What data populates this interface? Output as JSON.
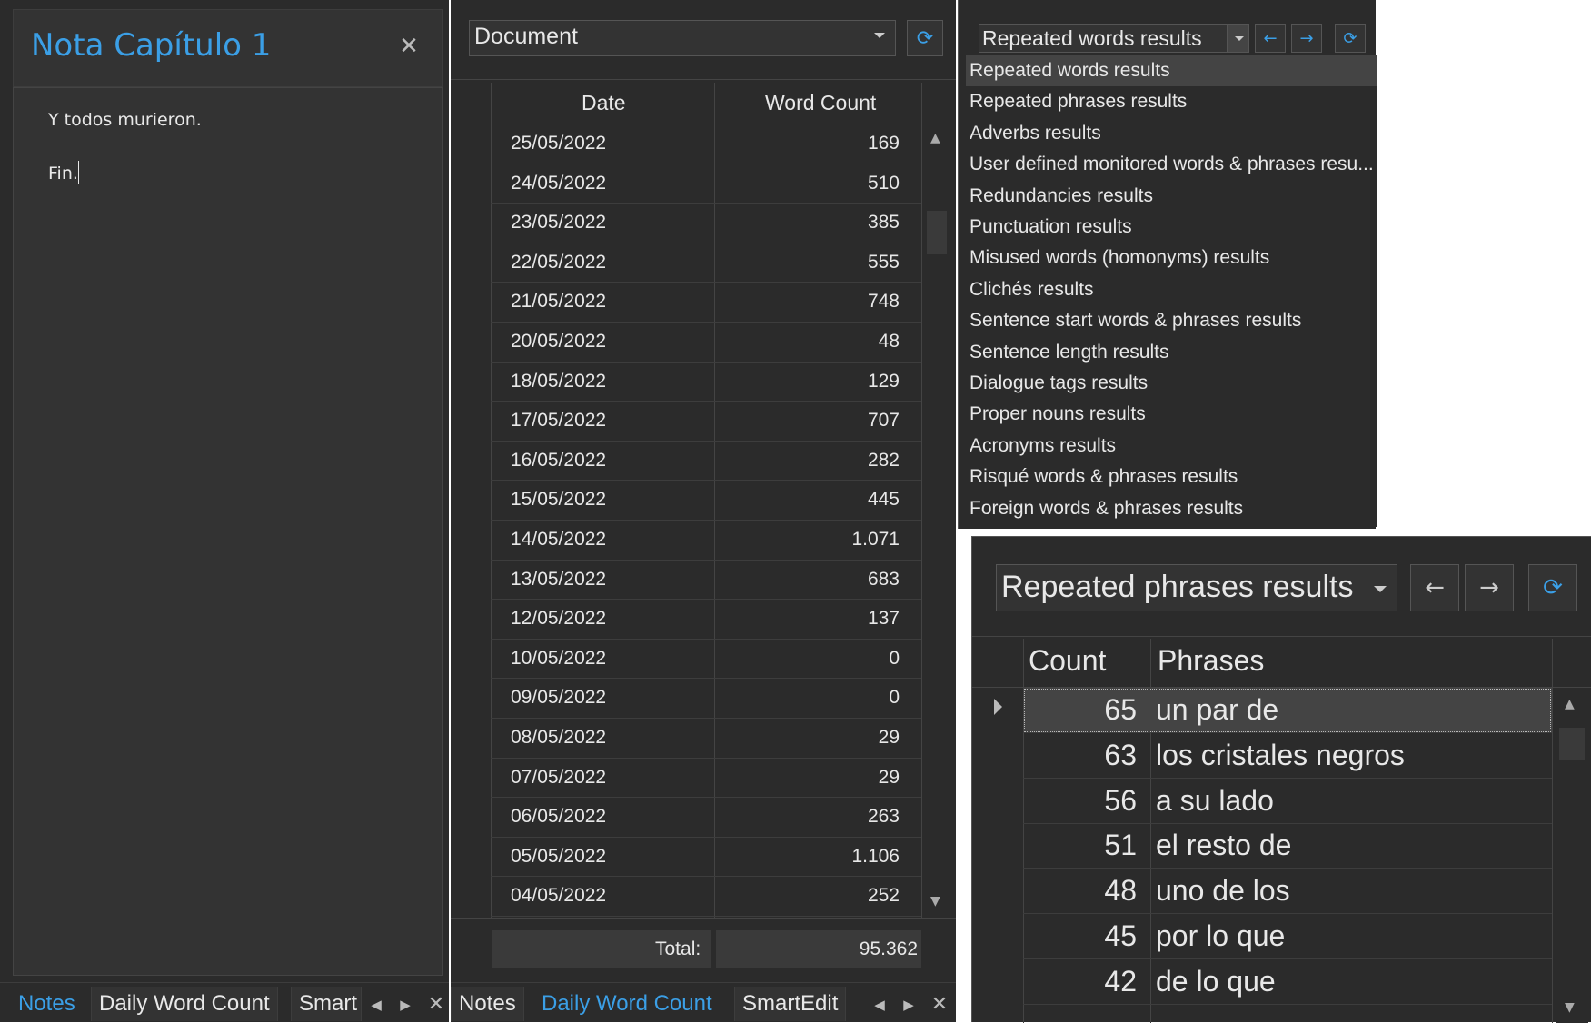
{
  "notes_panel": {
    "title": "Nota Capítulo 1",
    "close_icon": "close-icon",
    "lines": [
      "Y todos murieron.",
      "Fin."
    ],
    "tabs": [
      "Notes",
      "Daily Word Count",
      "Smart"
    ]
  },
  "word_count_panel": {
    "scope_select": "Document",
    "columns": [
      "Date",
      "Word Count"
    ],
    "rows": [
      {
        "date": "25/05/2022",
        "count": "169"
      },
      {
        "date": "24/05/2022",
        "count": "510"
      },
      {
        "date": "23/05/2022",
        "count": "385"
      },
      {
        "date": "22/05/2022",
        "count": "555"
      },
      {
        "date": "21/05/2022",
        "count": "748"
      },
      {
        "date": "20/05/2022",
        "count": "48"
      },
      {
        "date": "18/05/2022",
        "count": "129"
      },
      {
        "date": "17/05/2022",
        "count": "707"
      },
      {
        "date": "16/05/2022",
        "count": "282"
      },
      {
        "date": "15/05/2022",
        "count": "445"
      },
      {
        "date": "14/05/2022",
        "count": "1.071"
      },
      {
        "date": "13/05/2022",
        "count": "683"
      },
      {
        "date": "12/05/2022",
        "count": "137"
      },
      {
        "date": "10/05/2022",
        "count": "0"
      },
      {
        "date": "09/05/2022",
        "count": "0"
      },
      {
        "date": "08/05/2022",
        "count": "29"
      },
      {
        "date": "07/05/2022",
        "count": "29"
      },
      {
        "date": "06/05/2022",
        "count": "263"
      },
      {
        "date": "05/05/2022",
        "count": "1.106"
      },
      {
        "date": "04/05/2022",
        "count": "252"
      }
    ],
    "total_label": "Total:",
    "total_value": "95.362",
    "tabs": [
      "Notes",
      "Daily Word Count",
      "SmartEdit"
    ]
  },
  "results_dropdown": {
    "selected": "Repeated words results",
    "options": [
      "Repeated words results",
      "Repeated phrases results",
      "Adverbs results",
      "User defined monitored words & phrases resu...",
      "Redundancies results",
      "Punctuation results",
      "Misused words (homonyms) results",
      "Clichés results",
      "Sentence start words & phrases results",
      "Sentence length results",
      "Dialogue tags results",
      "Proper nouns results",
      "Acronyms results",
      "Risqué words & phrases results",
      "Foreign words & phrases results"
    ]
  },
  "phrases_panel": {
    "selected": "Repeated phrases results",
    "columns": [
      "Count",
      "Phrases"
    ],
    "rows": [
      {
        "count": "65",
        "phrase": "un par de"
      },
      {
        "count": "63",
        "phrase": "los cristales negros"
      },
      {
        "count": "56",
        "phrase": "a su lado"
      },
      {
        "count": "51",
        "phrase": "el resto de"
      },
      {
        "count": "48",
        "phrase": "uno de los"
      },
      {
        "count": "45",
        "phrase": "por lo que"
      },
      {
        "count": "42",
        "phrase": "de lo que"
      }
    ]
  },
  "colors": {
    "background": "#2b2b2b",
    "accent": "#3b9fe6",
    "text": "#e8e8e8"
  }
}
